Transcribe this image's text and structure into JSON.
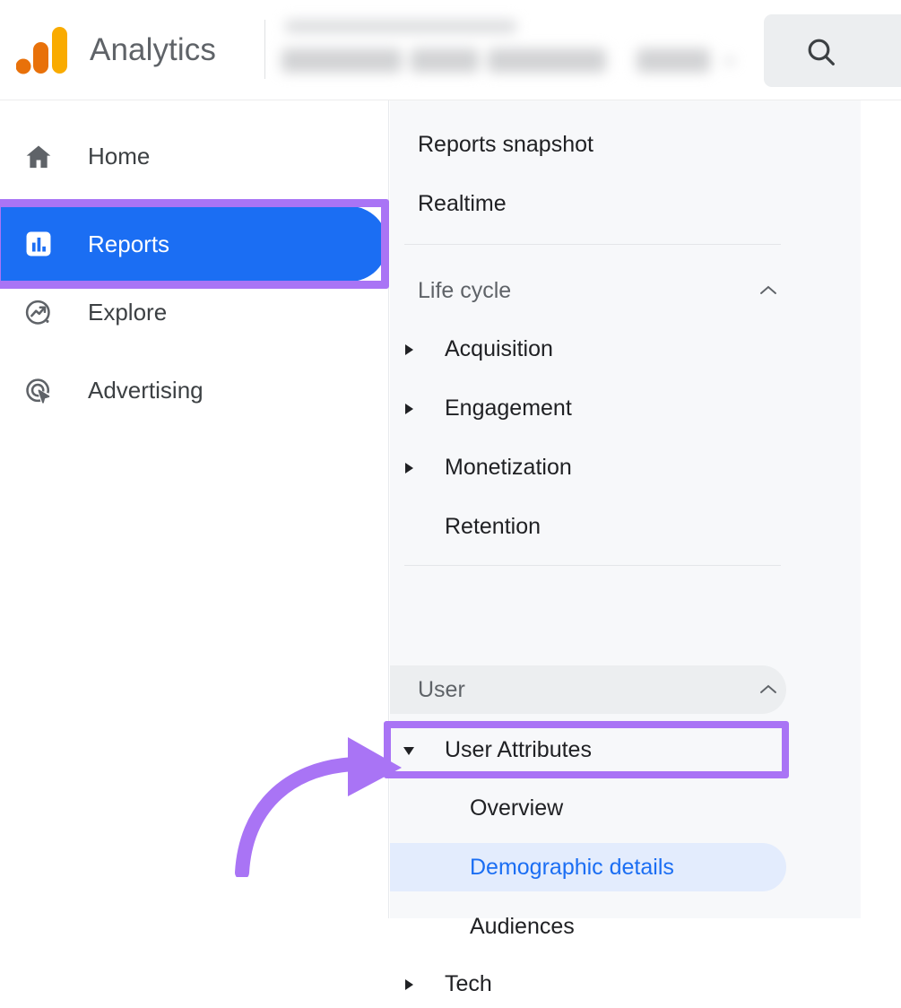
{
  "header": {
    "app_title": "Analytics",
    "logo_icon": "google-analytics-logo",
    "search_icon": "search-icon",
    "account_selector_blurred": true
  },
  "sidebar": {
    "items": [
      {
        "label": "Home",
        "icon": "home-icon",
        "selected": false
      },
      {
        "label": "Reports",
        "icon": "bar-chart-icon",
        "selected": true
      },
      {
        "label": "Explore",
        "icon": "explore-icon",
        "selected": false
      },
      {
        "label": "Advertising",
        "icon": "advertising-icon",
        "selected": false
      }
    ]
  },
  "report_nav": {
    "snapshot": "Reports snapshot",
    "realtime": "Realtime",
    "life_cycle_header": "Life cycle",
    "life_cycle_items": [
      {
        "label": "Acquisition",
        "expandable": true
      },
      {
        "label": "Engagement",
        "expandable": true
      },
      {
        "label": "Monetization",
        "expandable": true
      },
      {
        "label": "Retention",
        "expandable": false
      }
    ],
    "user_header": "User",
    "user_attributes": "User Attributes",
    "user_attribute_items": [
      {
        "label": "Overview",
        "selected": false
      },
      {
        "label": "Demographic details",
        "selected": true
      },
      {
        "label": "Audiences",
        "selected": false
      }
    ],
    "tech": "Tech"
  },
  "annotations": {
    "color": "#a974f5",
    "reports_highlight": "reports-nav-item",
    "user_attributes_highlight": "user-attributes-item",
    "arrow_points_to": "Demographic details"
  },
  "colors": {
    "selected_blue": "#1b6ef3",
    "selected_pill_bg": "#e3ecfd",
    "panel_bg": "#f7f8fa",
    "annotation_purple": "#a974f5",
    "logo_orange": "#e8710a",
    "logo_yellow": "#f9ab00"
  }
}
